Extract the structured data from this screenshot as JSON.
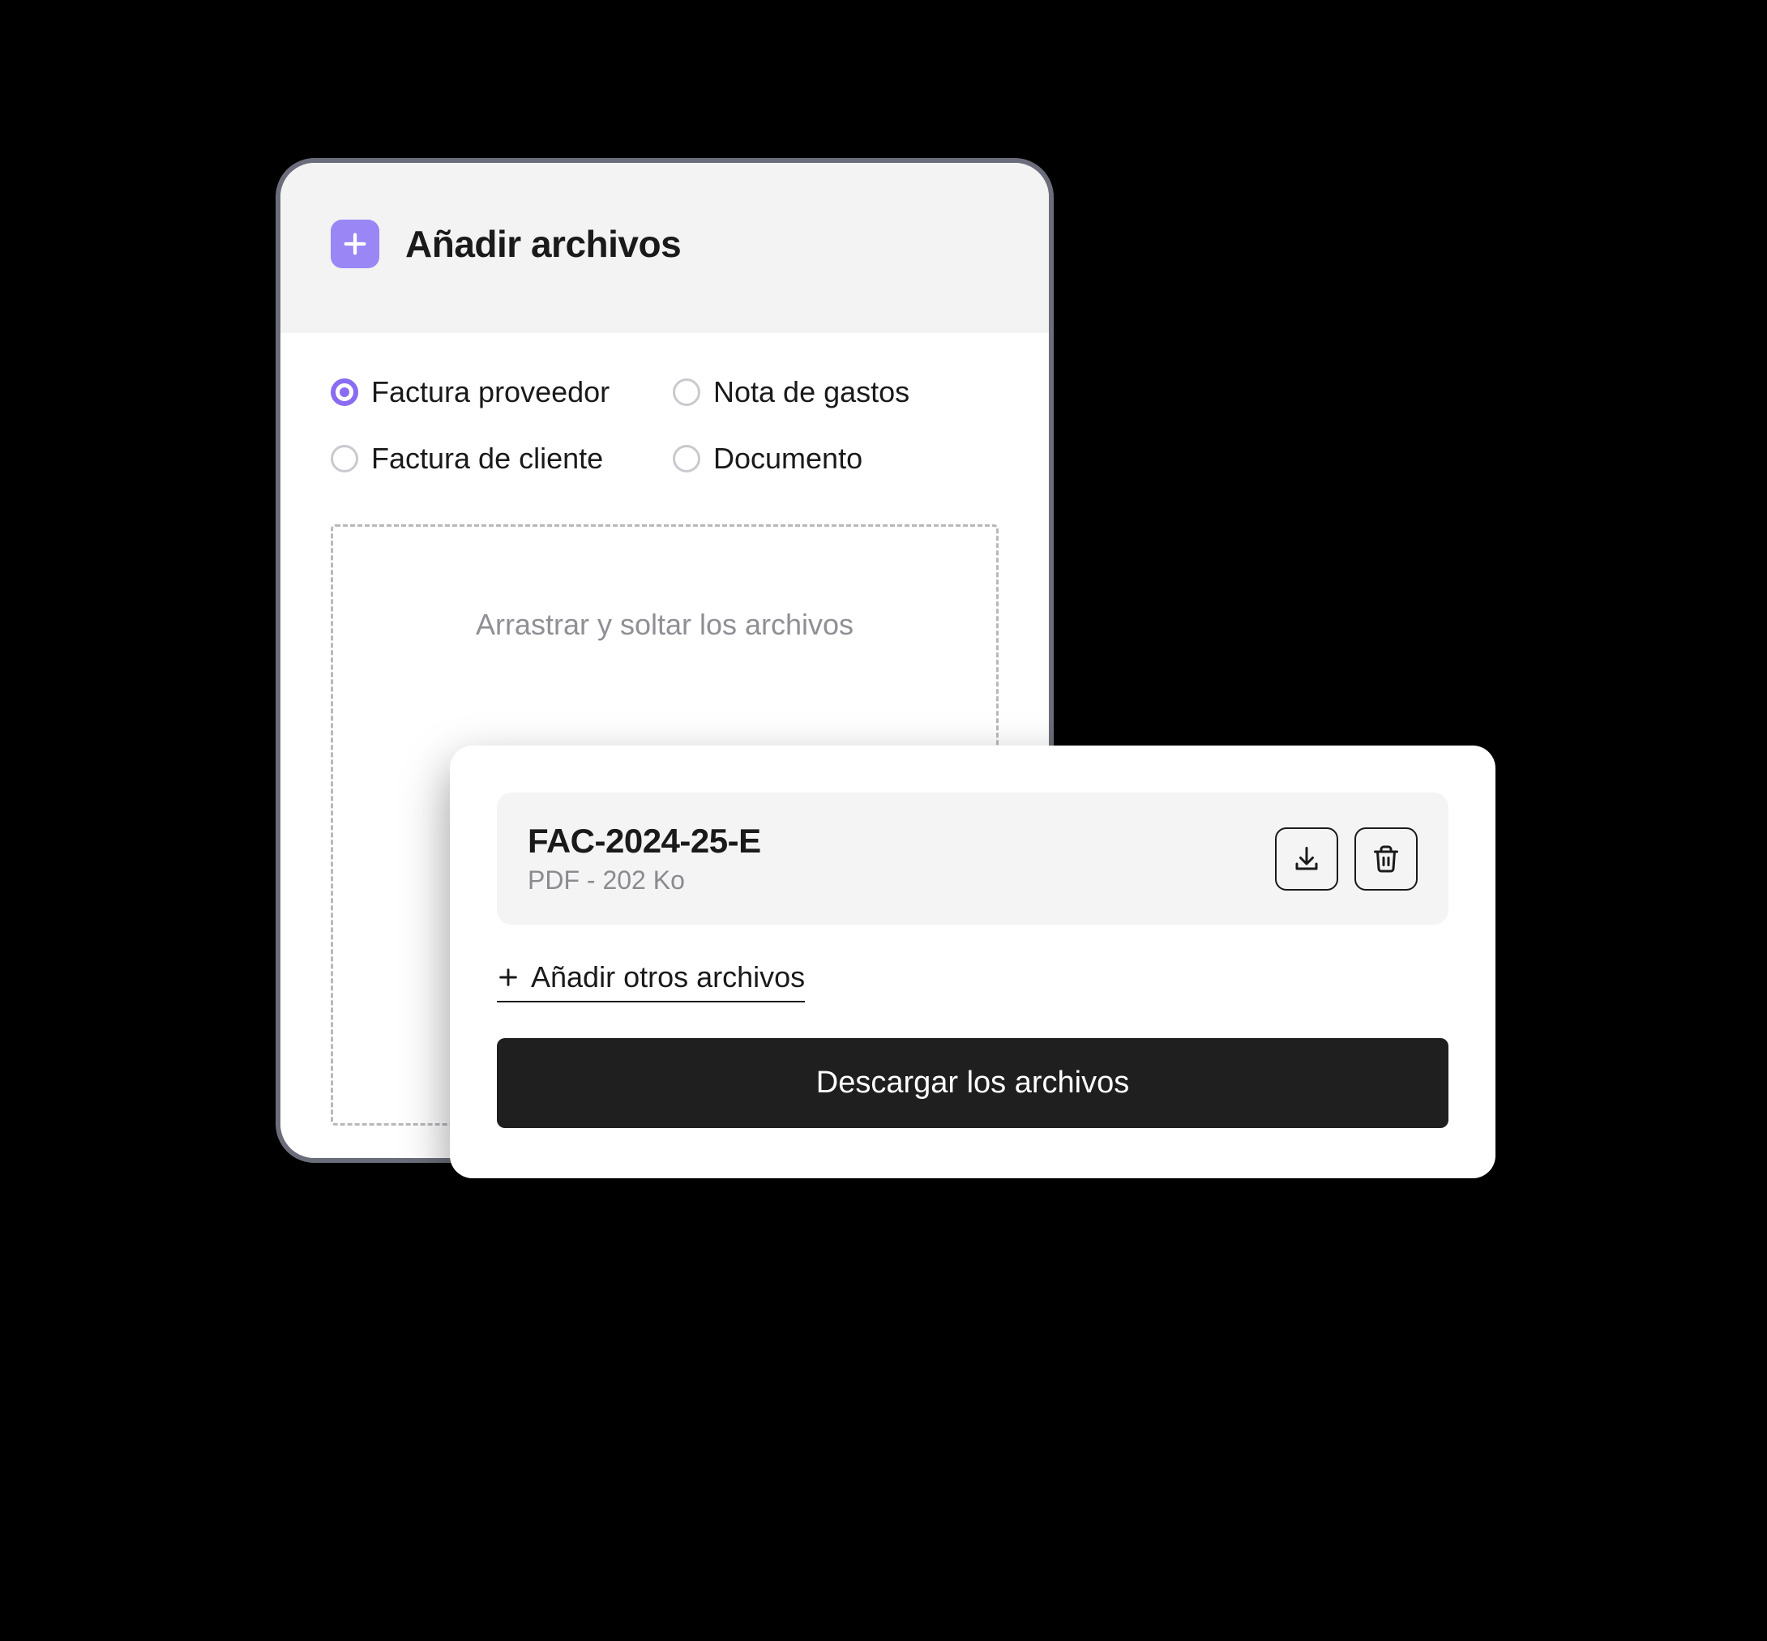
{
  "colors": {
    "accent": "#8a6cf2",
    "badge": "#9a86f5",
    "dark": "#1f1f1f"
  },
  "header": {
    "title": "Añadir archivos"
  },
  "options": [
    {
      "label": "Factura proveedor",
      "selected": true
    },
    {
      "label": "Nota de gastos",
      "selected": false
    },
    {
      "label": "Factura de cliente",
      "selected": false
    },
    {
      "label": "Documento",
      "selected": false
    }
  ],
  "dropzone": {
    "line1": "Arrastrar y soltar los archivos"
  },
  "file": {
    "name": "FAC-2024-25-E",
    "meta": "PDF - 202 Ko"
  },
  "actions": {
    "add_more": "Añadir otros archivos",
    "download": "Descargar los archivos"
  }
}
